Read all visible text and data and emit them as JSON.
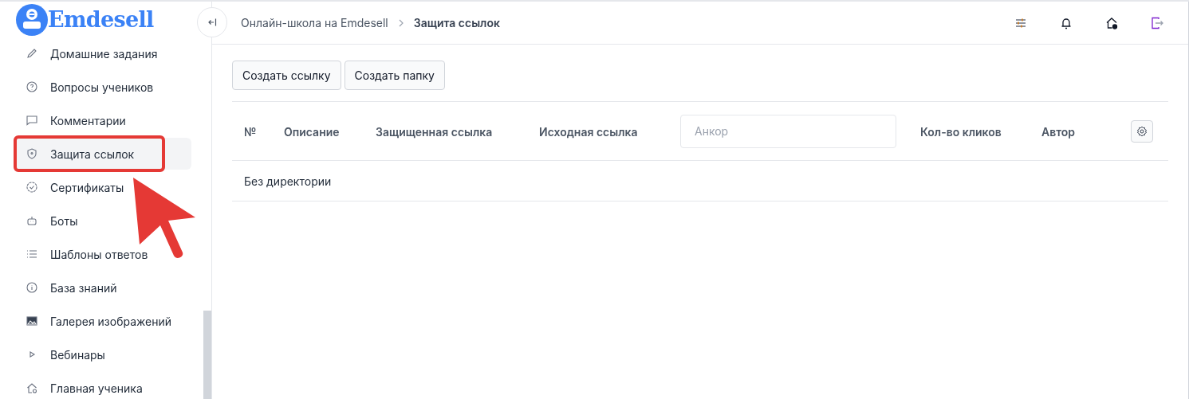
{
  "logo": {
    "text": "Emdesell"
  },
  "sidebar": {
    "items": [
      {
        "label": "Домашние задания",
        "selected": false,
        "annotated": false
      },
      {
        "label": "Вопросы учеников",
        "selected": false,
        "annotated": false
      },
      {
        "label": "Комментарии",
        "selected": false,
        "annotated": false
      },
      {
        "label": "Защита ссылок",
        "selected": true,
        "annotated": true
      },
      {
        "label": "Сертификаты",
        "selected": false,
        "annotated": false
      },
      {
        "label": "Боты",
        "selected": false,
        "annotated": false
      },
      {
        "label": "Шаблоны ответов",
        "selected": false,
        "annotated": false
      },
      {
        "label": "База знаний",
        "selected": false,
        "annotated": false
      },
      {
        "label": "Галерея изображений",
        "selected": false,
        "annotated": false
      },
      {
        "label": "Вебинары",
        "selected": false,
        "annotated": false
      },
      {
        "label": "Главная ученика",
        "selected": false,
        "annotated": false
      }
    ]
  },
  "breadcrumb": [
    {
      "label": "Онлайн-школа на Emdesell",
      "current": false
    },
    {
      "label": "Защита ссылок",
      "current": true
    }
  ],
  "toolbar": {
    "buttons": [
      "Создать ссылку",
      "Создать папку"
    ]
  },
  "table": {
    "columns": [
      {
        "kind": "text",
        "label": "№"
      },
      {
        "kind": "text",
        "label": "Описание"
      },
      {
        "kind": "text",
        "label": "Защищенная ссылка"
      },
      {
        "kind": "text",
        "label": "Исходная ссылка"
      },
      {
        "kind": "input",
        "placeholder": "Анкор"
      },
      {
        "kind": "text",
        "label": "Кол-во кликов"
      },
      {
        "kind": "text",
        "label": "Автор"
      },
      {
        "kind": "settings"
      }
    ],
    "rows": [
      {
        "label": "Без директории"
      }
    ]
  }
}
